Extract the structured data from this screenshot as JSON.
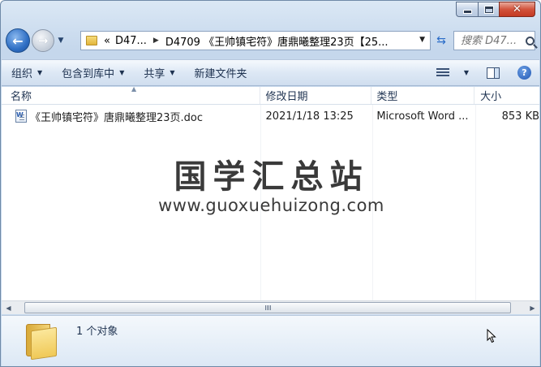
{
  "window": {
    "caption_min": "minimize",
    "caption_max": "maximize",
    "caption_close": "✕"
  },
  "nav": {
    "back_glyph": "←",
    "forward_glyph": "→",
    "breadcrumb": [
      "D47...",
      "D4709 《王帅镇宅符》唐鼎曦整理23页【25..."
    ],
    "overflow_chevrons": "«",
    "search_placeholder": "搜索 D47..."
  },
  "toolbar": {
    "organize": "组织",
    "include_in_library": "包含到库中",
    "share": "共享",
    "new_folder": "新建文件夹"
  },
  "columns": {
    "name": "名称",
    "date_modified": "修改日期",
    "type": "类型",
    "size": "大小"
  },
  "files": [
    {
      "name": "《王帅镇宅符》唐鼎曦整理23页.doc",
      "date_modified": "2021/1/18 13:25",
      "type": "Microsoft Word ...",
      "size": "853 KB"
    }
  ],
  "watermark": {
    "title": "国学汇总站",
    "url": "www.guoxuehuizong.com"
  },
  "status": {
    "item_count": "1 个对象"
  },
  "colors": {
    "window_frame": "#c5d7ec",
    "close_button": "#c43a23",
    "accent_blue": "#2f6fc4",
    "folder_yellow": "#f0c957"
  }
}
